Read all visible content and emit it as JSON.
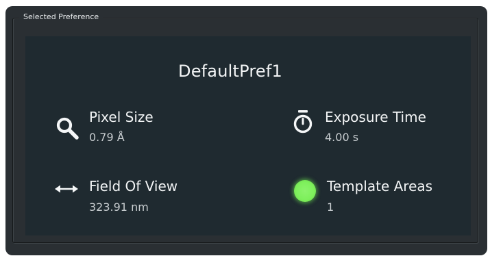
{
  "group": {
    "legend": "Selected Preference",
    "title": "DefaultPref1"
  },
  "items": {
    "pixel_size": {
      "label": "Pixel Size",
      "value": "0.79 Å",
      "icon": "search-icon"
    },
    "exposure_time": {
      "label": "Exposure Time",
      "value": "4.00 s",
      "icon": "stopwatch-icon"
    },
    "field_of_view": {
      "label": "Field Of View",
      "value": "323.91 nm",
      "icon": "horizontal-arrows-icon"
    },
    "template_areas": {
      "label": "Template Areas",
      "value": "1",
      "icon": "status-dot-icon"
    }
  },
  "colors": {
    "outer_background": "#2a2f33",
    "panel_background": "#1f2a30",
    "status_dot": "#7ef05c"
  }
}
